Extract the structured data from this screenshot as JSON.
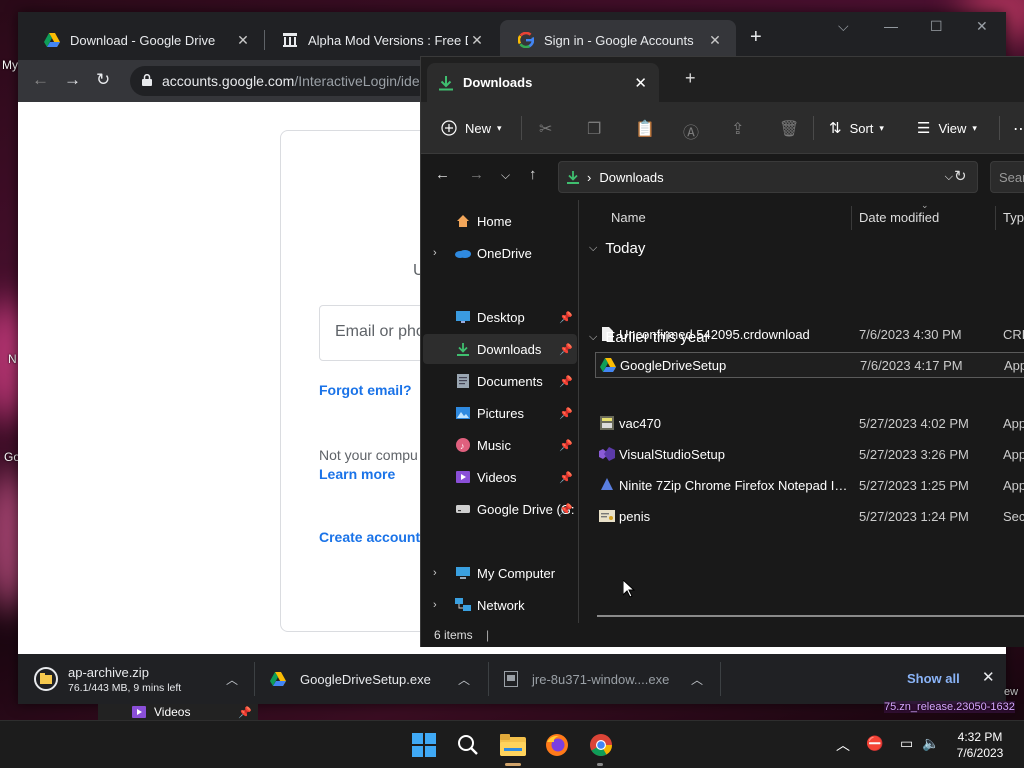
{
  "desktop": {
    "left_texts": [
      "My",
      "N",
      "Go"
    ],
    "overlay_item": {
      "label": "Videos"
    },
    "corner_text": "75.zn_release.23050-1632",
    "corner_text2": "ew"
  },
  "chrome": {
    "tabs": [
      {
        "title": "Download - Google Drive",
        "icon": "google-drive-icon"
      },
      {
        "title": "Alpha Mod Versions : Free Down",
        "icon": "archive-icon"
      },
      {
        "title": "Sign in - Google Accounts",
        "icon": "google-g-icon",
        "active": true
      }
    ],
    "url_host": "accounts.google.com",
    "url_path": "/InteractiveLogin/ide",
    "page": {
      "text_u": "U",
      "email_placeholder": "Email or pho",
      "forgot_email": "Forgot email?",
      "not_your": "Not your compu",
      "learn_more": "Learn more",
      "create_account": "Create account"
    },
    "downloads": [
      {
        "name": "ap-archive.zip",
        "status": "76.1/443 MB, 9 mins left",
        "icon": "zip-icon"
      },
      {
        "name": "GoogleDriveSetup.exe",
        "icon": "google-drive-icon"
      },
      {
        "name": "jre-8u371-window....exe",
        "icon": "exe-icon"
      }
    ],
    "show_all": "Show all"
  },
  "explorer": {
    "tab_title": "Downloads",
    "toolbar": {
      "new": "New",
      "sort": "Sort",
      "view": "View"
    },
    "address": "Downloads",
    "search_placeholder": "Searc",
    "nav": {
      "home": "Home",
      "onedrive": "OneDrive",
      "desktop": "Desktop",
      "downloads": "Downloads",
      "documents": "Documents",
      "pictures": "Pictures",
      "music": "Music",
      "videos": "Videos",
      "google_drive": "Google Drive (G:",
      "my_computer": "My Computer",
      "network": "Network"
    },
    "columns": {
      "name": "Name",
      "date": "Date modified",
      "type": "Type"
    },
    "groups": {
      "today": "Today",
      "earlier": "Earlier this year"
    },
    "files_today": [
      {
        "name": "Unconfirmed 542095.crdownload",
        "date": "7/6/2023 4:30 PM",
        "type": "CRD"
      },
      {
        "name": "GoogleDriveSetup",
        "date": "7/6/2023 4:17 PM",
        "type": "Appl"
      }
    ],
    "files_earlier": [
      {
        "name": "vac470",
        "date": "5/27/2023 4:02 PM",
        "type": "Appl"
      },
      {
        "name": "VisualStudioSetup",
        "date": "5/27/2023 3:26 PM",
        "type": "Appl"
      },
      {
        "name": "Ninite 7Zip Chrome Firefox Notepad Inst...",
        "date": "5/27/2023 1:25 PM",
        "type": "Appl"
      },
      {
        "name": "penis",
        "date": "5/27/2023 1:24 PM",
        "type": "Secu"
      }
    ],
    "status": "6 items"
  },
  "taskbar": {
    "time": "4:32 PM",
    "date": "7/6/2023"
  }
}
